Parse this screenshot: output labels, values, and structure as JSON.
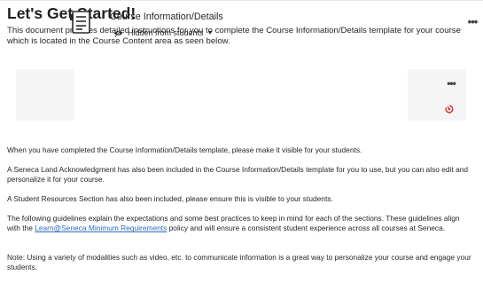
{
  "page": {
    "title": "Let's Get Started!",
    "intro": "This document provides detailed instructions for you to complete the Course Information/Details template for your course which is located in the Course Content area as seen below.",
    "more_icon": "ellipsis-icon"
  },
  "content_item": {
    "name": "Course Information/Details",
    "visibility": "Hidden from students",
    "icons": {
      "document": "document-icon",
      "visibility": "eye-slash-icon",
      "caret": "chevron-down-icon",
      "more": "ellipsis-icon",
      "release": "release-conditions-icon"
    },
    "colors": {
      "release_icon": "#e0303a",
      "card_background": "#f5f5f5"
    }
  },
  "paragraphs": {
    "p1": "When you have completed the Course Information/Details template, please make it visible for your students.",
    "p2": "A Seneca Land Acknowledgment has also been included in the Course Information/Details template for you to use, but you can also edit and personalize it for your course.",
    "p3": "A Student Resources Section has also been included, please ensure this is visible to your students.",
    "p4_before": "The following guidelines explain the expectations and some best practices to keep in mind for each of the sections. These guidelines align with the ",
    "p4_link": "Learn@Seneca Minimum Requirements",
    "p4_after": " policy and will ensure a consistent student experience across all courses at Seneca.",
    "p5": "Note: Using a variety of modalities such as video, etc. to communicate information is a great way to personalize your course and engage your students."
  },
  "link_color": "#2a6ebb"
}
